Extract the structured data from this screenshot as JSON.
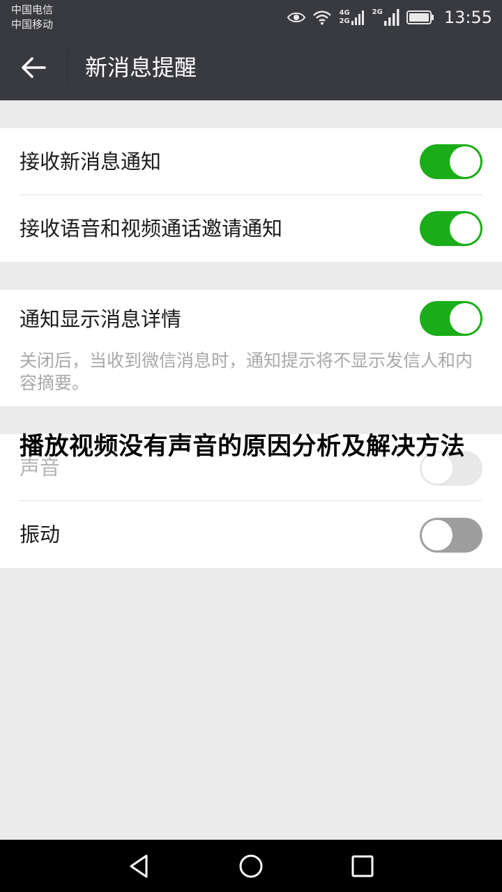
{
  "status_bar": {
    "carrier_1": "中国电信",
    "carrier_2": "中国移动",
    "net_1_top": "4G",
    "net_1_bottom": "2G",
    "net_2": "2G",
    "time": "13:55"
  },
  "header": {
    "title": "新消息提醒",
    "back_icon": "arrow-left-icon"
  },
  "group1": [
    {
      "label": "接收新消息通知",
      "toggle": "on"
    },
    {
      "label": "接收语音和视频通话邀请通知",
      "toggle": "on"
    }
  ],
  "group2": {
    "label": "通知显示消息详情",
    "toggle": "on",
    "note": "关闭后，当收到微信消息时，通知提示将不显示发信人和内容摘要。"
  },
  "group3": [
    {
      "label": "声音",
      "toggle": "off",
      "enabled": false
    },
    {
      "label": "振动",
      "toggle": "off",
      "enabled": true
    }
  ],
  "overlay": {
    "title": "播放视频没有声音的原因分析及解决方法"
  },
  "colors": {
    "header_bg": "#393a3f",
    "toggle_on": "#1aad19",
    "toggle_off": "#9e9e9e",
    "page_bg": "#ebebeb"
  },
  "nav_icons": [
    "back-triangle-icon",
    "home-circle-icon",
    "recents-square-icon"
  ]
}
